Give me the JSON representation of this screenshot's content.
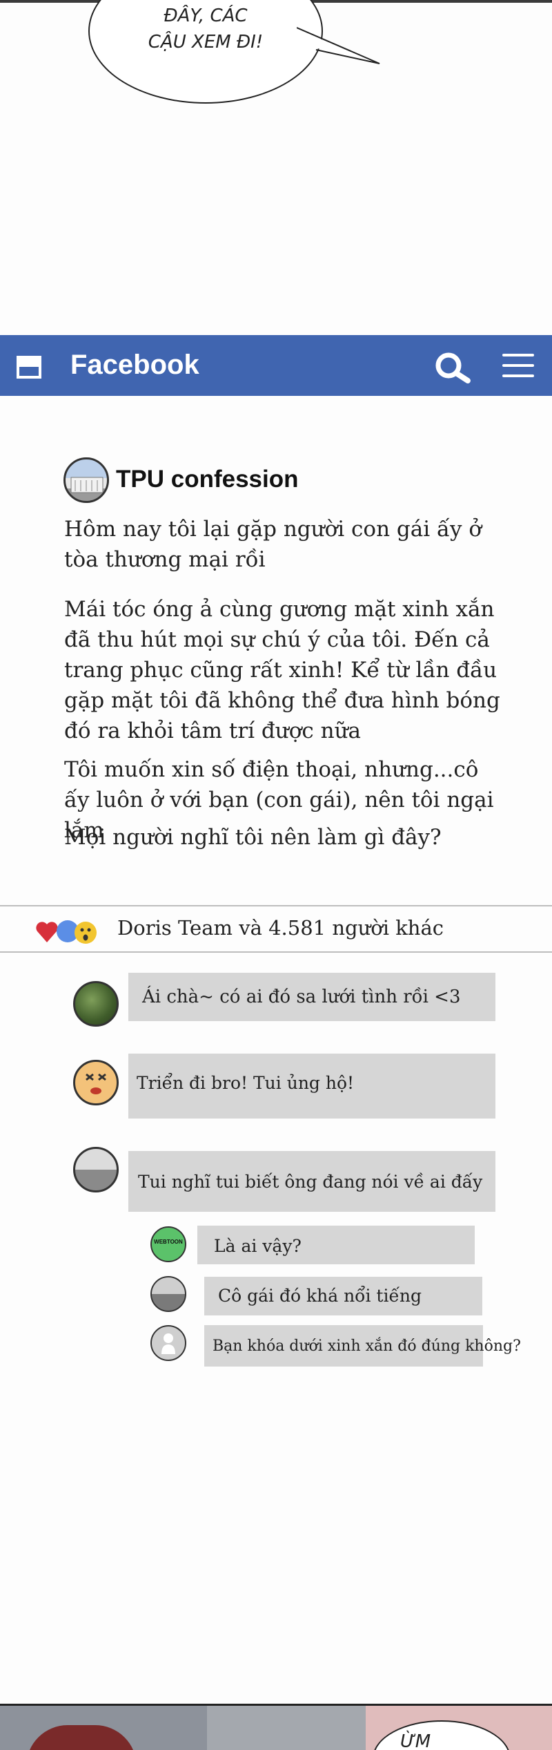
{
  "comic_top": {
    "speech": [
      "ĐÂY, CÁC",
      "CẬU XEM ĐI!"
    ]
  },
  "app_bar": {
    "title": "Facebook"
  },
  "post": {
    "author": "TPU confession",
    "paragraphs": [
      "Hôm nay tôi lại gặp người con gái ấy ở tòa thương mại rồi",
      "Mái tóc óng ả cùng gương mặt xinh xắn đã thu hút mọi sự chú ý của tôi. Đến cả trang phục cũng rất xinh! Kể từ lần đầu gặp mặt tôi đã không thể đưa hình bóng đó ra khỏi tâm trí được nữa",
      "Tôi muốn xin số điện thoại, nhưng...cô ấy luôn ở với bạn (con gái), nên tôi ngại lắm",
      "Mọi người nghĩ tôi nên làm gì đây?"
    ],
    "likes": "Doris Team và 4.581 người khác"
  },
  "comments": [
    {
      "text": "Ái chà~ có ai đó sa lưới tình rồi <3"
    },
    {
      "text": "Triển đi bro! Tui ủng hộ!"
    },
    {
      "text": "Tui nghĩ tui biết ông đang nói về ai đấy"
    }
  ],
  "replies": [
    {
      "avatar_label": "WEBTOON",
      "text": "Là ai vậy?"
    },
    {
      "text": "Cô gái đó khá nổi tiếng"
    },
    {
      "text": "Bạn khóa dưới xinh xắn đó đúng không?"
    }
  ],
  "comic_bottom": {
    "speech": "ỪM"
  },
  "colors": {
    "facebook_blue": "#4065b0",
    "comment_bg": "#d6d6d6"
  }
}
